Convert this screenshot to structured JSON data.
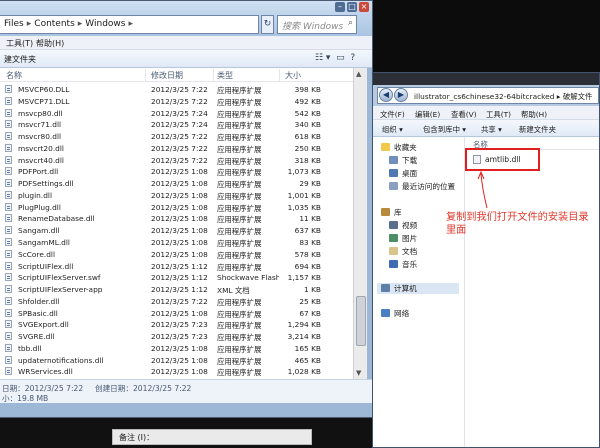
{
  "left_window": {
    "breadcrumb": [
      "Files",
      "Contents",
      "Windows"
    ],
    "search_placeholder": "搜索 Windows",
    "menu": {
      "tools": "工具(T)",
      "help": "帮助(H)"
    },
    "toolbar": {
      "new_folder": "建文件夹"
    },
    "columns": {
      "name": "名称",
      "date": "修改日期",
      "type": "类型",
      "size": "大小"
    },
    "files": [
      {
        "name": "MSVCP60.DLL",
        "date": "2012/3/25 7:22",
        "type": "应用程序扩展",
        "size": "398 KB"
      },
      {
        "name": "MSVCP71.DLL",
        "date": "2012/3/25 7:22",
        "type": "应用程序扩展",
        "size": "492 KB"
      },
      {
        "name": "msvcp80.dll",
        "date": "2012/3/25 7:24",
        "type": "应用程序扩展",
        "size": "542 KB"
      },
      {
        "name": "msvcr71.dll",
        "date": "2012/3/25 7:24",
        "type": "应用程序扩展",
        "size": "340 KB"
      },
      {
        "name": "msvcr80.dll",
        "date": "2012/3/25 7:22",
        "type": "应用程序扩展",
        "size": "618 KB"
      },
      {
        "name": "msvcrt20.dll",
        "date": "2012/3/25 7:22",
        "type": "应用程序扩展",
        "size": "250 KB"
      },
      {
        "name": "msvcrt40.dll",
        "date": "2012/3/25 7:22",
        "type": "应用程序扩展",
        "size": "318 KB"
      },
      {
        "name": "PDFPort.dll",
        "date": "2012/3/25 1:08",
        "type": "应用程序扩展",
        "size": "1,073 KB"
      },
      {
        "name": "PDFSettings.dll",
        "date": "2012/3/25 1:08",
        "type": "应用程序扩展",
        "size": "29 KB"
      },
      {
        "name": "plugin.dll",
        "date": "2012/3/25 1:08",
        "type": "应用程序扩展",
        "size": "1,001 KB"
      },
      {
        "name": "PlugPlug.dll",
        "date": "2012/3/25 1:08",
        "type": "应用程序扩展",
        "size": "1,035 KB"
      },
      {
        "name": "RenameDatabase.dll",
        "date": "2012/3/25 1:08",
        "type": "应用程序扩展",
        "size": "11 KB"
      },
      {
        "name": "Sangam.dll",
        "date": "2012/3/25 1:08",
        "type": "应用程序扩展",
        "size": "637 KB"
      },
      {
        "name": "SangamML.dll",
        "date": "2012/3/25 1:08",
        "type": "应用程序扩展",
        "size": "83 KB"
      },
      {
        "name": "ScCore.dll",
        "date": "2012/3/25 1:08",
        "type": "应用程序扩展",
        "size": "578 KB"
      },
      {
        "name": "ScriptUIFlex.dll",
        "date": "2012/3/25 1:12",
        "type": "应用程序扩展",
        "size": "694 KB"
      },
      {
        "name": "ScriptUIFlexServer.swf",
        "date": "2012/3/25 1:12",
        "type": "Shockwave Flash...",
        "size": "1,157 KB"
      },
      {
        "name": "ScriptUIFlexServer-app",
        "date": "2012/3/25 1:12",
        "type": "XML 文档",
        "size": "1 KB"
      },
      {
        "name": "Shfolder.dll",
        "date": "2012/3/25 7:22",
        "type": "应用程序扩展",
        "size": "25 KB"
      },
      {
        "name": "SPBasic.dll",
        "date": "2012/3/25 1:08",
        "type": "应用程序扩展",
        "size": "67 KB"
      },
      {
        "name": "SVGExport.dll",
        "date": "2012/3/25 7:23",
        "type": "应用程序扩展",
        "size": "1,294 KB"
      },
      {
        "name": "SVGRE.dll",
        "date": "2012/3/25 7:23",
        "type": "应用程序扩展",
        "size": "3,214 KB"
      },
      {
        "name": "tbb.dll",
        "date": "2012/3/25 1:08",
        "type": "应用程序扩展",
        "size": "165 KB"
      },
      {
        "name": "updaternotifications.dll",
        "date": "2012/3/25 1:08",
        "type": "应用程序扩展",
        "size": "465 KB"
      },
      {
        "name": "WRServices.dll",
        "date": "2012/3/25 1:08",
        "type": "应用程序扩展",
        "size": "1,028 KB"
      }
    ],
    "status": {
      "modified": "日期：2012/3/25 7:22",
      "created": "创建日期：2012/3/25 7:22",
      "size": "小：19.8 MB"
    }
  },
  "right_window": {
    "address": "illustrator_cs6chinese32-64bitcracked ▸ 破解文件",
    "menu": {
      "file": "文件(F)",
      "edit": "编辑(E)",
      "view": "查看(V)",
      "tools": "工具(T)",
      "help": "帮助(H)"
    },
    "toolbar": {
      "organize": "组织 ▾",
      "include": "包含到库中 ▾",
      "share": "共享 ▾",
      "new_folder": "新建文件夹"
    },
    "nav": {
      "favorites": "收藏夹",
      "download": "下载",
      "desktop": "桌面",
      "recent": "最近访问的位置",
      "libraries": "库",
      "videos": "视频",
      "pictures": "图片",
      "documents": "文档",
      "music": "音乐",
      "computer": "计算机",
      "network": "网络"
    },
    "column_name": "名称",
    "file": "amtlib.dll"
  },
  "annotation": "复制到我们打开文件的安装目录里面",
  "bottom_hint": "备注 (I)：",
  "colors": {
    "annotation_red": "#e03a2c",
    "highlight_box": "#e01f1f"
  }
}
